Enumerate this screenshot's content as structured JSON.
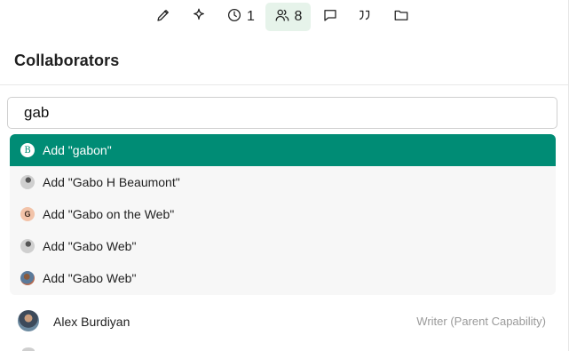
{
  "toolbar": {
    "tools": [
      {
        "icon": "pencil-icon",
        "count": ""
      },
      {
        "icon": "sparkle-icon",
        "count": ""
      },
      {
        "icon": "clock-icon",
        "count": "1"
      },
      {
        "icon": "users-icon",
        "count": "8",
        "active": true
      },
      {
        "icon": "comment-icon",
        "count": ""
      },
      {
        "icon": "quote-icon",
        "count": ""
      },
      {
        "icon": "folder-icon",
        "count": ""
      }
    ],
    "clock_count": "1",
    "collaborators_count": "8"
  },
  "panel": {
    "title": "Collaborators"
  },
  "search": {
    "value": "gab",
    "placeholder": ""
  },
  "suggestions": [
    {
      "label": "Add \"gabon\"",
      "avatar_text": "B",
      "avatar": "letter-avatar",
      "highlighted": true
    },
    {
      "label": "Add \"Gabo H Beaumont\"",
      "avatar_text": "",
      "avatar": "photo-avatar",
      "highlighted": false
    },
    {
      "label": "Add \"Gabo on the Web\"",
      "avatar_text": "G",
      "avatar": "letter-avatar",
      "highlighted": false
    },
    {
      "label": "Add \"Gabo Web\"",
      "avatar_text": "",
      "avatar": "photo-avatar",
      "highlighted": false
    },
    {
      "label": "Add \"Gabo Web\"",
      "avatar_text": "",
      "avatar": "photo-avatar",
      "highlighted": false
    }
  ],
  "collaborators": [
    {
      "name": "Alex Burdiyan",
      "role": "Writer (Parent Capability)"
    }
  ],
  "colors": {
    "accent": "#008c75",
    "active_tab_bg": "#e6f3ea",
    "dropdown_bg": "#f7f7f7",
    "muted_text": "#9a9a9a"
  }
}
